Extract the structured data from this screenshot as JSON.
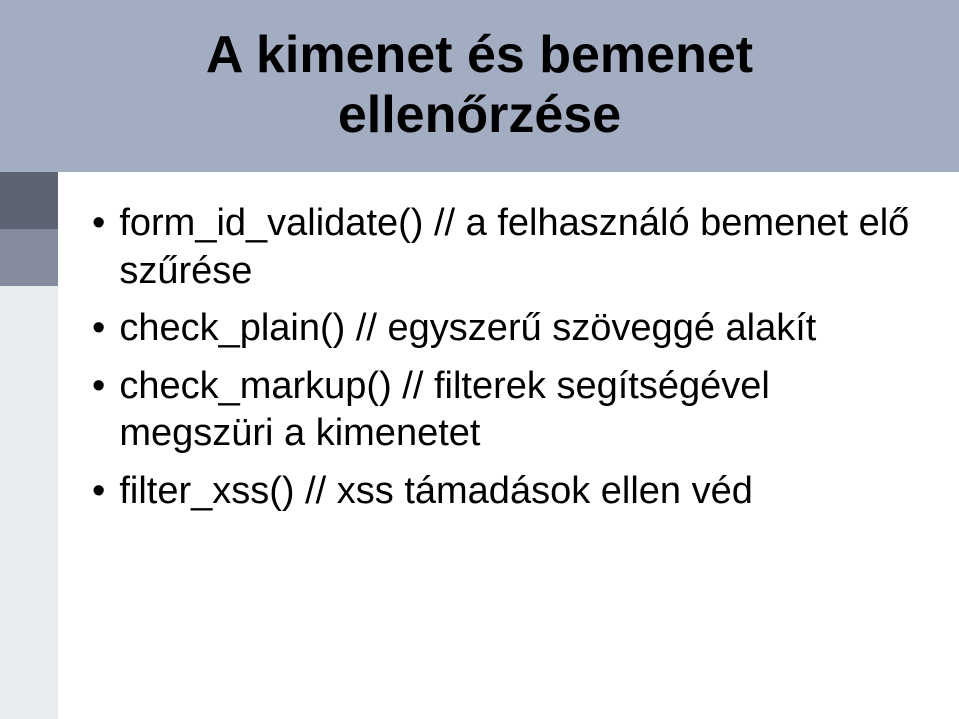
{
  "title_line1": "A kimenet és bemenet",
  "title_line2": "ellenőrzése",
  "bullets": [
    "form_id_validate() // a felhasználó bemenet elő szűrése",
    "check_plain() // egyszerű szöveggé alakít",
    "check_markup() // filterek segítségével megszüri a kimenetet",
    "filter_xss() // xss támadások ellen véd"
  ]
}
